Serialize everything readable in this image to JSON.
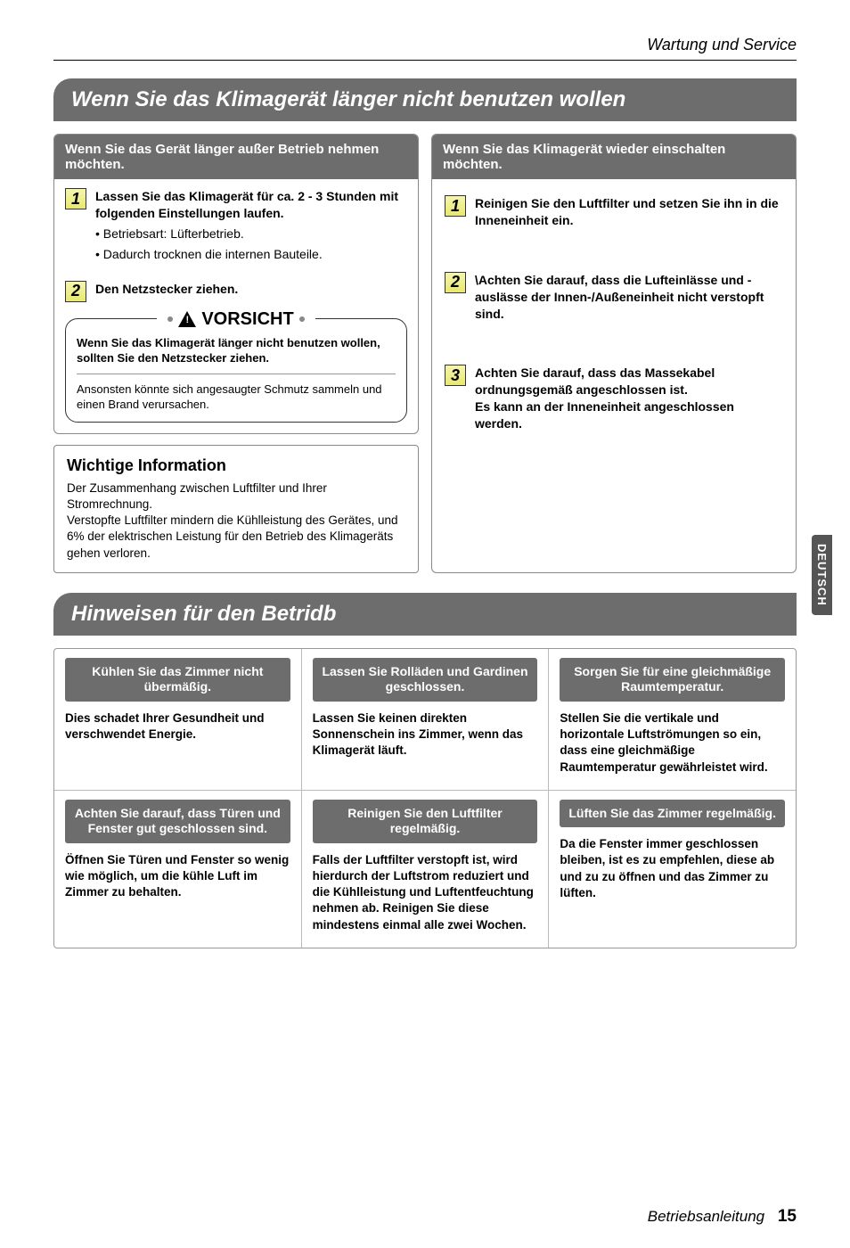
{
  "header": {
    "running_head": "Wartung und Service"
  },
  "side_tab": "DEUTSCH",
  "section1": {
    "title": "Wenn Sie das Klimagerät länger nicht benutzen wollen",
    "left_card_header": "Wenn Sie das Gerät länger außer Betrieb nehmen möchten.",
    "left_steps": [
      {
        "num": 1,
        "bold_lines": "Lassen Sie das Klimagerät für ca. 2 - 3 Stunden mit folgenden Einstellungen laufen.",
        "bullets": [
          "• Betriebsart: Lüfterbetrieb.",
          "• Dadurch trocknen die internen Bauteile."
        ]
      },
      {
        "num": 2,
        "bold_lines": "Den Netzstecker ziehen.",
        "bullets": []
      }
    ],
    "caution": {
      "label": "VORSICHT",
      "bold": "Wenn Sie das Klimagerät länger nicht benutzen wollen, sollten Sie den Netzstecker ziehen.",
      "text": "Ansonsten könnte sich angesaugter Schmutz sammeln und einen Brand verursachen."
    },
    "info": {
      "title": "Wichtige Information",
      "p1": "Der Zusammenhang zwischen Luftfilter und Ihrer Stromrechnung.",
      "p2": "Verstopfte Luftfilter mindern die Kühlleistung des Gerätes, und 6% der elektrischen Leistung für den Betrieb des Klimageräts gehen verloren."
    },
    "right_card_header": "Wenn Sie das Klimagerät wieder einschalten möchten.",
    "right_steps": [
      {
        "num": 1,
        "bold_lines": "Reinigen Sie den Luftfilter und setzen Sie ihn in die Inneneinheit ein."
      },
      {
        "num": 2,
        "bold_lines": "\\Achten Sie darauf, dass die Lufteinlässe und -auslässe der Innen-/Außeneinheit nicht verstopft sind."
      },
      {
        "num": 3,
        "bold_lines": "Achten Sie darauf, dass das Massekabel ordnungsgemäß angeschlossen ist.\nEs kann an der Inneneinheit angeschlossen werden."
      }
    ]
  },
  "section2": {
    "title": "Hinweisen für den Betridb",
    "rows": [
      [
        {
          "head": "Kühlen Sie das Zimmer nicht übermäßig.",
          "body": "Dies schadet Ihrer Gesundheit und verschwendet Energie."
        },
        {
          "head": "Lassen Sie Rolläden und Gardinen geschlossen.",
          "body": "Lassen Sie keinen direkten Sonnenschein ins Zimmer, wenn das Klimagerät läuft."
        },
        {
          "head": "Sorgen Sie für eine gleichmäßige Raumtemperatur.",
          "body": "Stellen Sie die vertikale und horizontale Luftströmungen so ein, dass eine gleichmäßige Raumtemperatur gewährleistet wird."
        }
      ],
      [
        {
          "head": "Achten Sie darauf, dass Türen und Fenster gut geschlossen sind.",
          "body": "Öffnen Sie Türen und Fenster so wenig wie möglich, um die kühle Luft im Zimmer zu behalten."
        },
        {
          "head": "Reinigen Sie den Luftfilter regelmäßig.",
          "body": "Falls der Luftfilter verstopft ist, wird hierdurch der Luftstrom reduziert und die Kühlleistung und Luftentfeuchtung nehmen ab. Reinigen Sie diese mindestens einmal alle zwei Wochen."
        },
        {
          "head": "Lüften Sie das Zimmer regelmäßig.",
          "body": "Da die Fenster immer geschlossen bleiben, ist es zu empfehlen, diese ab und zu zu öffnen und das Zimmer zu lüften."
        }
      ]
    ]
  },
  "footer": {
    "label": "Betriebsanleitung",
    "page": "15"
  }
}
